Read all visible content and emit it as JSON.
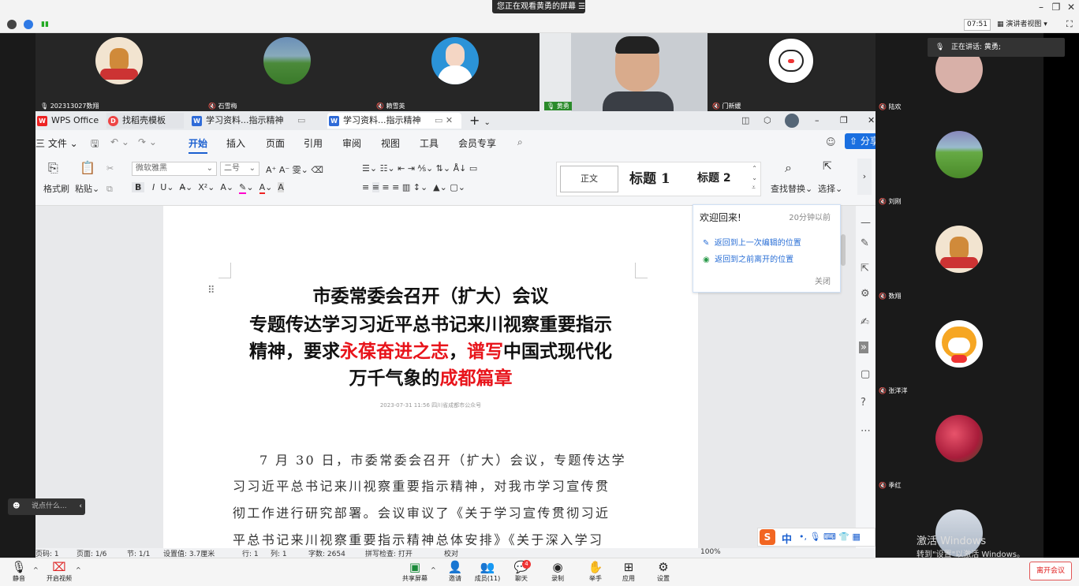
{
  "top": {
    "banner": "您正在观看黄勇的屏幕",
    "timer": "07:51",
    "view_mode": "演讲者视图"
  },
  "participants": [
    {
      "name": "202313027数翔"
    },
    {
      "name": "石雪梅"
    },
    {
      "name": "賴雪英"
    },
    {
      "name": "黄勇"
    },
    {
      "name": "门新媛"
    }
  ],
  "right_panel": {
    "speaking": "正在讲话: 黄勇;",
    "names": [
      "陆欢",
      "刘刚",
      "数翔",
      "张洋洋",
      "季红"
    ]
  },
  "wps": {
    "tabs": [
      "WPS Office",
      "找稻壳模板",
      "学习资料...指示精神",
      "学习资料...指示精神"
    ],
    "menus": [
      "三 文件",
      "开始",
      "插入",
      "页面",
      "引用",
      "审阅",
      "视图",
      "工具",
      "会员专享"
    ],
    "share": "分享",
    "ribbon": {
      "format_painter": "格式刷",
      "paste": "粘贴",
      "font": "微软雅黑",
      "size": "二号",
      "style_normal": "正文",
      "style_h1": "标题 1",
      "style_h2": "标题 2",
      "find_replace": "查找替换",
      "select": "选择"
    },
    "doc": {
      "title1": "市委常委会召开（扩大）会议",
      "title2": "专题传达学习习近平总书记来川视察重要指示",
      "title3a": "精神，要求",
      "title3b": "永葆奋进之志",
      "title3c": "，",
      "title3d": "谱写",
      "title3e": "中国式现代化",
      "title4a": "万千气象的",
      "title4b": "成都篇章",
      "meta": "2023-07-31 11:56 四川省成都市公众号",
      "para": [
        "7 月 30 日，市委常委会召开（扩大）会议，专题传达学",
        "习习近平总书记来川视察重要指示精神，对我市学习宣传贯",
        "彻工作进行研究部署。会议审议了《关于学习宣传贯彻习近",
        "平总书记来川视察重要指示精神总体安排》《关于深入学习"
      ]
    },
    "welcome": {
      "title": "欢迎回来!",
      "time": "20分钟以前",
      "link1": "返回到上一次编辑的位置",
      "link2": "返回到之前离开的位置",
      "close": "关闭"
    },
    "status": {
      "page": "页码: 1",
      "pages": "页面: 1/6",
      "section": "节: 1/1",
      "setting": "设置值: 3.7厘米",
      "row": "行: 1",
      "col": "列: 1",
      "words": "字数: 2654",
      "spell": "拼写检查: 打开",
      "proof": "校对",
      "zoom": "100%"
    }
  },
  "ime": {
    "label": "中"
  },
  "chat": {
    "placeholder": "说点什么..."
  },
  "bottom": {
    "mute": "静音",
    "video": "开启视频",
    "share": "共享屏幕",
    "invite": "邀请",
    "members": "成员(11)",
    "chat": "聊天",
    "chat_badge": "4",
    "record": "录制",
    "hand": "举手",
    "apps": "应用",
    "settings": "设置",
    "leave": "离开会议"
  },
  "watermark": {
    "line1": "激活 Windows",
    "line2": "转到\"设置\"以激活 Windows。"
  }
}
